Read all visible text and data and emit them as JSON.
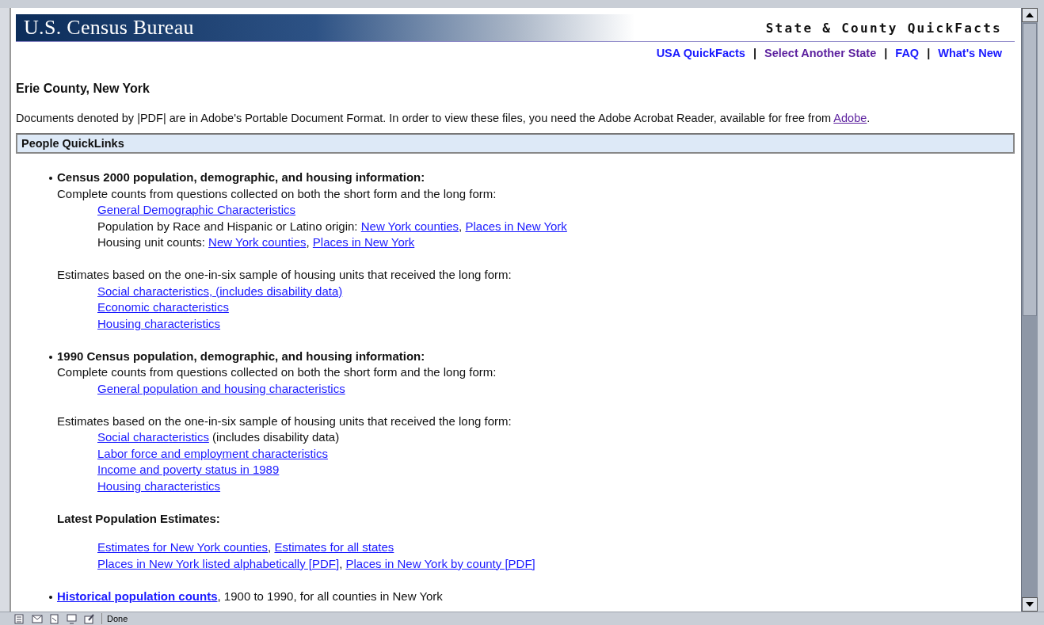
{
  "header": {
    "logo": "U.S. Census Bureau",
    "tagline": "State & County QuickFacts"
  },
  "nav_links": [
    {
      "label": "USA QuickFacts",
      "visited": false
    },
    {
      "label": "Select Another State",
      "visited": true
    },
    {
      "label": "FAQ",
      "visited": false
    },
    {
      "label": "What's New",
      "visited": false
    }
  ],
  "nav_separator": "|",
  "heading": "Erie County, New York",
  "notice": {
    "text": "Documents denoted by |PDF| are in Adobe's Portable Document Format. In order to view these files, you need the Adobe Acrobat Reader, available for free from ",
    "link": {
      "label": "Adobe",
      "visited": true
    },
    "tail": "."
  },
  "section_title": "People QuickLinks",
  "bullets": [
    {
      "kind": "heading",
      "title": "Census 2000 population, demographic, and housing information:",
      "groups": [
        {
          "kind": "intro",
          "text": "Complete counts from questions collected on both the short form and the long form:",
          "lines": [
            [
              {
                "kind": "link",
                "text": "General Demographic Characteristics"
              }
            ],
            [
              {
                "kind": "text",
                "text": "Population by Race and Hispanic or Latino origin: "
              },
              {
                "kind": "link",
                "text": "New York counties"
              },
              {
                "kind": "text",
                "text": ", "
              },
              {
                "kind": "link",
                "text": "Places in New York"
              }
            ],
            [
              {
                "kind": "text",
                "text": "Housing unit counts: "
              },
              {
                "kind": "link",
                "text": "New York counties"
              },
              {
                "kind": "text",
                "text": ", "
              },
              {
                "kind": "link",
                "text": "Places in New York"
              }
            ]
          ]
        },
        {
          "kind": "intro",
          "text": "Estimates based on the one-in-six sample of housing units that received the long form:",
          "lines": [
            [
              {
                "kind": "link",
                "text": "Social characteristics, (includes disability data)"
              }
            ],
            [
              {
                "kind": "link",
                "text": "Economic characteristics"
              }
            ],
            [
              {
                "kind": "link",
                "text": "Housing characteristics"
              }
            ]
          ]
        }
      ]
    },
    {
      "kind": "heading",
      "title": "1990 Census population, demographic, and housing information:",
      "groups": [
        {
          "kind": "intro",
          "text": "Complete counts from questions collected on both the short form and the long form:",
          "lines": [
            [
              {
                "kind": "link",
                "text": "General population and housing characteristics"
              }
            ]
          ]
        },
        {
          "kind": "intro",
          "text": "Estimates based on the one-in-six sample of housing units that received the long form:",
          "lines": [
            [
              {
                "kind": "link",
                "text": "Social characteristics"
              },
              {
                "kind": "text",
                "text": " (includes disability data)"
              }
            ],
            [
              {
                "kind": "link",
                "text": "Labor force and employment characteristics"
              }
            ],
            [
              {
                "kind": "link",
                "text": "Income and poverty status in 1989"
              }
            ],
            [
              {
                "kind": "link",
                "text": "Housing characteristics"
              }
            ]
          ]
        },
        {
          "kind": "subheading",
          "text": "Latest Population Estimates:",
          "lines": [
            [
              {
                "kind": "link",
                "text": "Estimates for New York counties"
              },
              {
                "kind": "text",
                "text": ", "
              },
              {
                "kind": "link",
                "text": "Estimates for all states"
              }
            ],
            [
              {
                "kind": "link",
                "text": "Places in New York listed alphabetically [PDF]"
              },
              {
                "kind": "text",
                "text": ", "
              },
              {
                "kind": "link",
                "text": "Places in New York by county [PDF]"
              }
            ]
          ]
        }
      ]
    },
    {
      "kind": "link",
      "title": "Historical population counts",
      "tail": ", 1900 to 1990, for all counties in New York"
    }
  ],
  "status_bar": {
    "text": "Done"
  }
}
